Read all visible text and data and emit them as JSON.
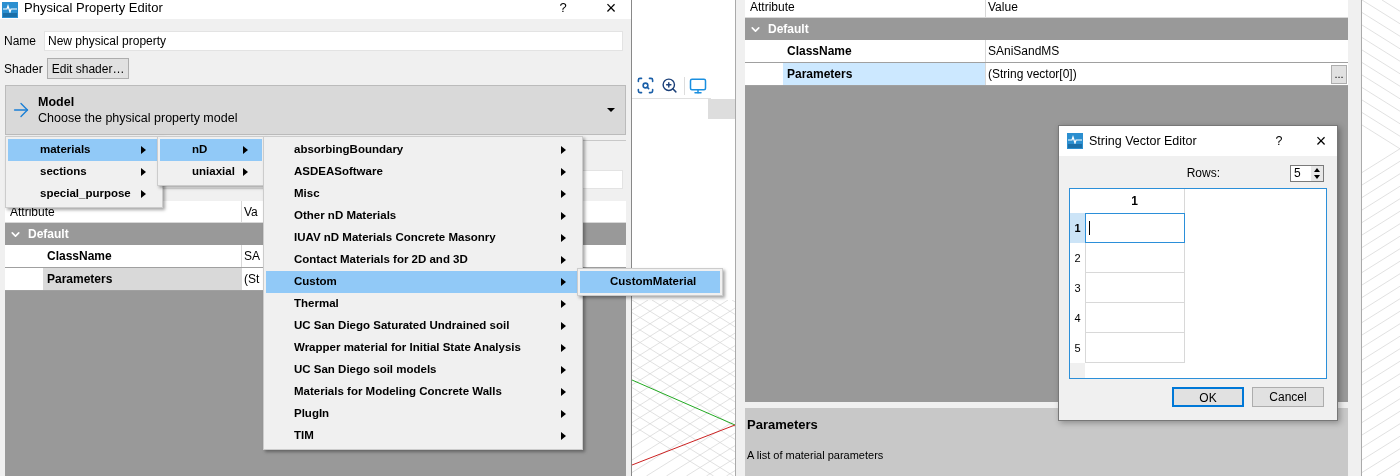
{
  "property_editor": {
    "title": "Physical Property Editor",
    "help": "?",
    "close": "×",
    "name_label": "Name",
    "name_value": "New physical property",
    "shader_label": "Shader",
    "shader_button": "Edit shader…",
    "model": {
      "title": "Model",
      "subtitle": "Choose the physical property model"
    },
    "table": {
      "columns": [
        "Attribute",
        "Va"
      ],
      "group": {
        "label": "Default",
        "expanded": true
      },
      "rows": [
        {
          "name": "ClassName",
          "value": "SA",
          "selected": false
        },
        {
          "name": "Parameters",
          "value": "(St",
          "selected": true
        }
      ]
    }
  },
  "menus": [
    {
      "items": [
        {
          "label": "materials",
          "selected": true,
          "submenu": true
        },
        {
          "label": "sections",
          "selected": false,
          "submenu": true
        },
        {
          "label": "special_purpose",
          "selected": false,
          "submenu": true
        }
      ]
    },
    {
      "items": [
        {
          "label": "nD",
          "selected": true,
          "submenu": true
        },
        {
          "label": "uniaxial",
          "selected": false,
          "submenu": true
        }
      ]
    },
    {
      "items": [
        {
          "label": "absorbingBoundary",
          "selected": false,
          "submenu": true
        },
        {
          "label": "ASDEASoftware",
          "selected": false,
          "submenu": true
        },
        {
          "label": "Misc",
          "selected": false,
          "submenu": true
        },
        {
          "label": "Other nD Materials",
          "selected": false,
          "submenu": true
        },
        {
          "label": "IUAV nD Materials Concrete Masonry",
          "selected": false,
          "submenu": true
        },
        {
          "label": "Contact Materials for 2D and 3D",
          "selected": false,
          "submenu": true
        },
        {
          "label": "Custom",
          "selected": true,
          "submenu": true
        },
        {
          "label": "Thermal",
          "selected": false,
          "submenu": true
        },
        {
          "label": "UC San Diego Saturated Undrained soil",
          "selected": false,
          "submenu": true
        },
        {
          "label": "Wrapper material for Initial State Analysis",
          "selected": false,
          "submenu": true
        },
        {
          "label": "UC San Diego soil models",
          "selected": false,
          "submenu": true
        },
        {
          "label": "Materials for Modeling Concrete Walls",
          "selected": false,
          "submenu": true
        },
        {
          "label": "PlugIn",
          "selected": false,
          "submenu": true
        },
        {
          "label": "TIM",
          "selected": false,
          "submenu": true
        }
      ]
    },
    {
      "items": [
        {
          "label": "CustomMaterial",
          "selected": true,
          "submenu": false
        }
      ]
    }
  ],
  "attribute_panel": {
    "table": {
      "columns": [
        "Attribute",
        "Value"
      ],
      "group": {
        "label": "Default",
        "expanded": true
      },
      "rows": [
        {
          "name": "ClassName",
          "value": "SAniSandMS",
          "selected": false
        },
        {
          "name": "Parameters",
          "value": "(String vector[0])",
          "selected": true,
          "button": "..."
        }
      ]
    },
    "description": {
      "title": "Parameters",
      "text": "A list of material parameters"
    }
  },
  "dialog": {
    "title": "String Vector Editor",
    "help": "?",
    "close": "×",
    "rows_label": "Rows:",
    "rows_value": "5",
    "column": "1",
    "rows": [
      {
        "header": "1",
        "selected": true
      },
      {
        "header": "2",
        "selected": false
      },
      {
        "header": "3",
        "selected": false
      },
      {
        "header": "4",
        "selected": false
      },
      {
        "header": "5",
        "selected": false
      }
    ],
    "buttons": [
      {
        "label": "OK",
        "focused": true
      },
      {
        "label": "Cancel",
        "focused": false
      }
    ]
  }
}
